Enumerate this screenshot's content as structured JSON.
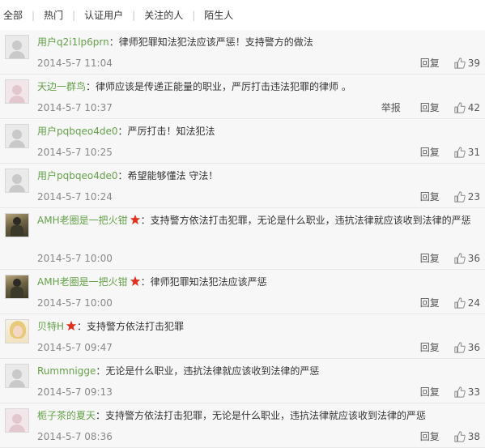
{
  "tabs": [
    {
      "label": "全部"
    },
    {
      "label": "热门"
    },
    {
      "label": "认证用户"
    },
    {
      "label": "关注的人"
    },
    {
      "label": "陌生人"
    }
  ],
  "comments": [
    {
      "user": "用户q2i1lp6prn",
      "text": "：律师犯罪知法犯法应该严惩！支持警方的做法",
      "time": "2014-5-7 11:04",
      "reply": "回复",
      "likes": "39"
    },
    {
      "user": "天边一群鸟",
      "text": "：律师应该是传递正能量的职业，严厉打击违法犯罪的律师 。",
      "time": "2014-5-7 10:37",
      "report": "举报",
      "reply": "回复",
      "likes": "42"
    },
    {
      "user": "用户pqbqeo4de0",
      "text": "：严厉打击！知法犯法",
      "time": "2014-5-7 10:25",
      "reply": "回复",
      "likes": "31"
    },
    {
      "user": "用户pqbqeo4de0",
      "text": "：希望能够懂法 守法！",
      "time": "2014-5-7 10:24",
      "reply": "回复",
      "likes": "23"
    },
    {
      "user": "AMH老圈是一把火钳",
      "text": "：支持警方依法打击犯罪，无论是什么职业，违抗法律就应该收到法律的严惩",
      "time": "2014-5-7 10:00",
      "reply": "回复",
      "likes": "36"
    },
    {
      "user": "AMH老圈是一把火钳",
      "text": "：律师犯罪知法犯法应该严惩",
      "time": "2014-5-7 10:00",
      "reply": "回复",
      "likes": "24"
    },
    {
      "user": "贝特H",
      "text": "：支持警方依法打击犯罪",
      "time": "2014-5-7 09:47",
      "reply": "回复",
      "likes": "36"
    },
    {
      "user": "Rummnigge",
      "text": "：无论是什么职业，违抗法律就应该收到法律的严惩",
      "time": "2014-5-7 09:13",
      "reply": "回复",
      "likes": "33"
    },
    {
      "user": "栀子茶的夏天",
      "text": "：支持警方依法打击犯罪，无论是什么职业，违抗法律就应该收到法律的严惩",
      "time": "2014-5-7 08:36",
      "reply": "回复",
      "likes": "38"
    }
  ],
  "colors": {
    "username": "#65a14a",
    "star": "#e0301e",
    "timestamp": "#888888"
  }
}
